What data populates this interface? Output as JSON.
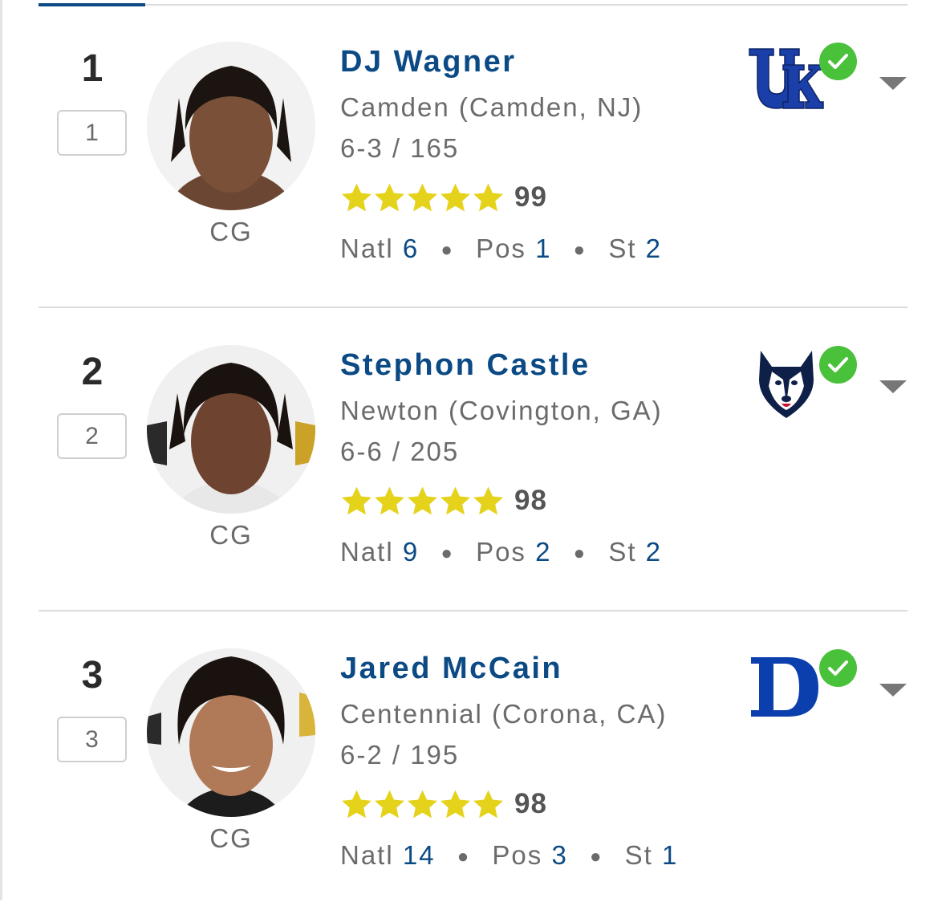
{
  "colors": {
    "name": "#0b4a84",
    "star": "#e4d21b",
    "check": "#4ac13a",
    "kentucky": "#1b3fa8",
    "duke": "#0c3fae",
    "uconn": "#0e1f48"
  },
  "players": [
    {
      "rank": "1",
      "rank_box": "1",
      "position": "CG",
      "name": "DJ Wagner",
      "school": "Camden (Camden, NJ)",
      "size": "6-3 / 165",
      "stars": 5,
      "rating": "99",
      "natl_label": "Natl",
      "natl": "6",
      "pos_label": "Pos",
      "pos": "1",
      "st_label": "St",
      "st": "2",
      "committed_school_logo": "kentucky-uk-logo",
      "committed": true
    },
    {
      "rank": "2",
      "rank_box": "2",
      "position": "CG",
      "name": "Stephon Castle",
      "school": "Newton (Covington, GA)",
      "size": "6-6 / 205",
      "stars": 5,
      "rating": "98",
      "natl_label": "Natl",
      "natl": "9",
      "pos_label": "Pos",
      "pos": "2",
      "st_label": "St",
      "st": "2",
      "committed_school_logo": "uconn-husky-logo",
      "committed": true
    },
    {
      "rank": "3",
      "rank_box": "3",
      "position": "CG",
      "name": "Jared McCain",
      "school": "Centennial (Corona, CA)",
      "size": "6-2 / 195",
      "stars": 5,
      "rating": "98",
      "natl_label": "Natl",
      "natl": "14",
      "pos_label": "Pos",
      "pos": "3",
      "st_label": "St",
      "st": "1",
      "committed_school_logo": "duke-d-logo",
      "committed": true
    }
  ]
}
